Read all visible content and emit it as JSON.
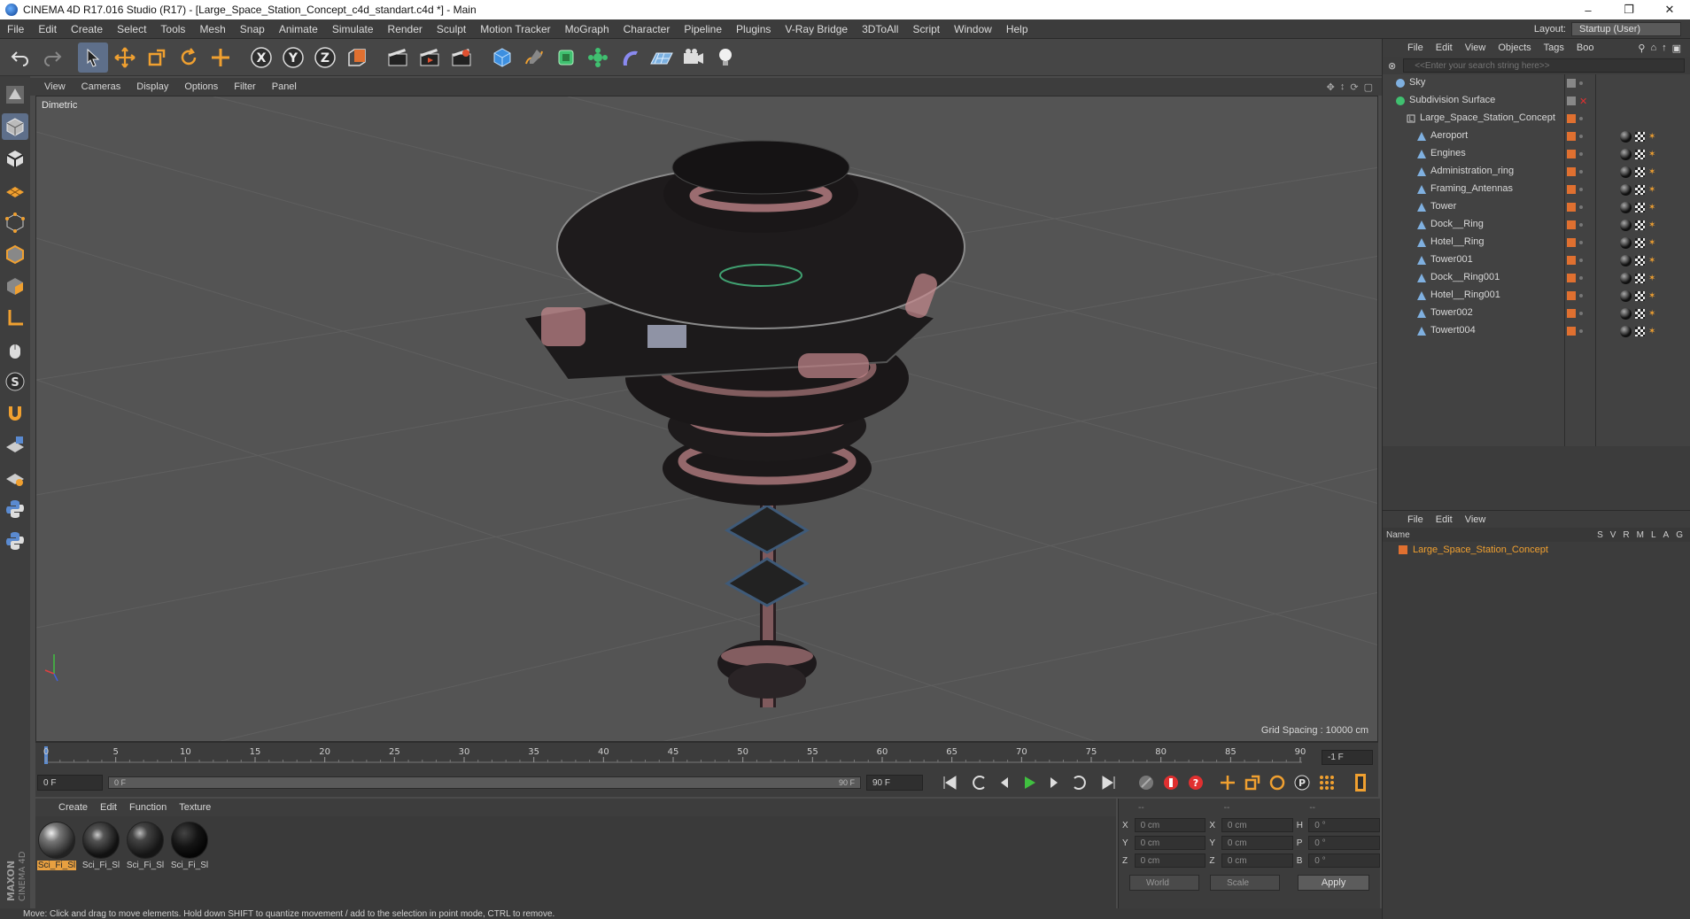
{
  "window": {
    "title": "CINEMA 4D R17.016 Studio (R17) - [Large_Space_Station_Concept_c4d_standart.c4d *] - Main",
    "minimize": "–",
    "maximize": "❐",
    "close": "✕"
  },
  "menu": [
    "File",
    "Edit",
    "Create",
    "Select",
    "Tools",
    "Mesh",
    "Snap",
    "Animate",
    "Simulate",
    "Render",
    "Sculpt",
    "Motion Tracker",
    "MoGraph",
    "Character",
    "Pipeline",
    "Plugins",
    "V-Ray Bridge",
    "3DToAll",
    "Script",
    "Window",
    "Help"
  ],
  "layout": {
    "label": "Layout:",
    "value": "Startup (User)"
  },
  "viewport": {
    "menu": [
      "View",
      "Cameras",
      "Display",
      "Options",
      "Filter",
      "Panel"
    ],
    "camera_label": "Dimetric",
    "grid_spacing": "Grid Spacing : 10000 cm"
  },
  "timeline": {
    "ticks": [
      "0",
      "5",
      "10",
      "15",
      "20",
      "25",
      "30",
      "35",
      "40",
      "45",
      "50",
      "55",
      "60",
      "65",
      "70",
      "75",
      "80",
      "85",
      "90"
    ],
    "current_frame": "-1 F",
    "start_frame": "0 F",
    "range_start": "0 F",
    "range_end": "90 F",
    "end_frame": "90 F"
  },
  "materials": {
    "menu": [
      "Create",
      "Edit",
      "Function",
      "Texture"
    ],
    "items": [
      {
        "label": "Sci_Fi_Sl",
        "selected": true
      },
      {
        "label": "Sci_Fi_Sl",
        "selected": false
      },
      {
        "label": "Sci_Fi_Sl",
        "selected": false
      },
      {
        "label": "Sci_Fi_Sl",
        "selected": false
      }
    ]
  },
  "coords": {
    "headers": [
      "--",
      "--",
      "--"
    ],
    "rows": [
      {
        "a1": "X",
        "v1": "0 cm",
        "a2": "X",
        "v2": "0 cm",
        "a3": "H",
        "v3": "0 °"
      },
      {
        "a1": "Y",
        "v1": "0 cm",
        "a2": "Y",
        "v2": "0 cm",
        "a3": "P",
        "v3": "0 °"
      },
      {
        "a1": "Z",
        "v1": "0 cm",
        "a2": "Z",
        "v2": "0 cm",
        "a3": "B",
        "v3": "0 °"
      }
    ],
    "world": "World",
    "scale": "Scale",
    "apply": "Apply"
  },
  "objects": {
    "menu": [
      "File",
      "Edit",
      "View",
      "Objects",
      "Tags",
      "Boo"
    ],
    "search_placeholder": "<<Enter your search string here>>",
    "items": [
      {
        "name": "Sky",
        "indent": 0
      },
      {
        "name": "Subdivision Surface",
        "indent": 0
      },
      {
        "name": "Large_Space_Station_Concept",
        "indent": 1
      },
      {
        "name": "Aeroport",
        "indent": 2
      },
      {
        "name": "Engines",
        "indent": 2
      },
      {
        "name": "Administration_ring",
        "indent": 2
      },
      {
        "name": "Framing_Antennas",
        "indent": 2
      },
      {
        "name": "Tower",
        "indent": 2
      },
      {
        "name": "Dock__Ring",
        "indent": 2
      },
      {
        "name": "Hotel__Ring",
        "indent": 2
      },
      {
        "name": "Tower001",
        "indent": 2
      },
      {
        "name": "Dock__Ring001",
        "indent": 2
      },
      {
        "name": "Hotel__Ring001",
        "indent": 2
      },
      {
        "name": "Tower002",
        "indent": 2
      },
      {
        "name": "Towert004",
        "indent": 2
      }
    ]
  },
  "attributes": {
    "menu": [
      "File",
      "Edit",
      "View"
    ],
    "name_header": "Name",
    "columns": [
      "S",
      "V",
      "R",
      "M",
      "L",
      "A",
      "G"
    ],
    "row_name": "Large_Space_Station_Concept"
  },
  "status": "Move: Click and drag to move elements. Hold down SHIFT to quantize movement / add to the selection in point mode, CTRL to remove.",
  "colors": {
    "accent": "#f0a030",
    "viewport_bg": "#545454",
    "panel_bg": "#3c3c3c",
    "selection_blue": "#5e6f8a"
  }
}
